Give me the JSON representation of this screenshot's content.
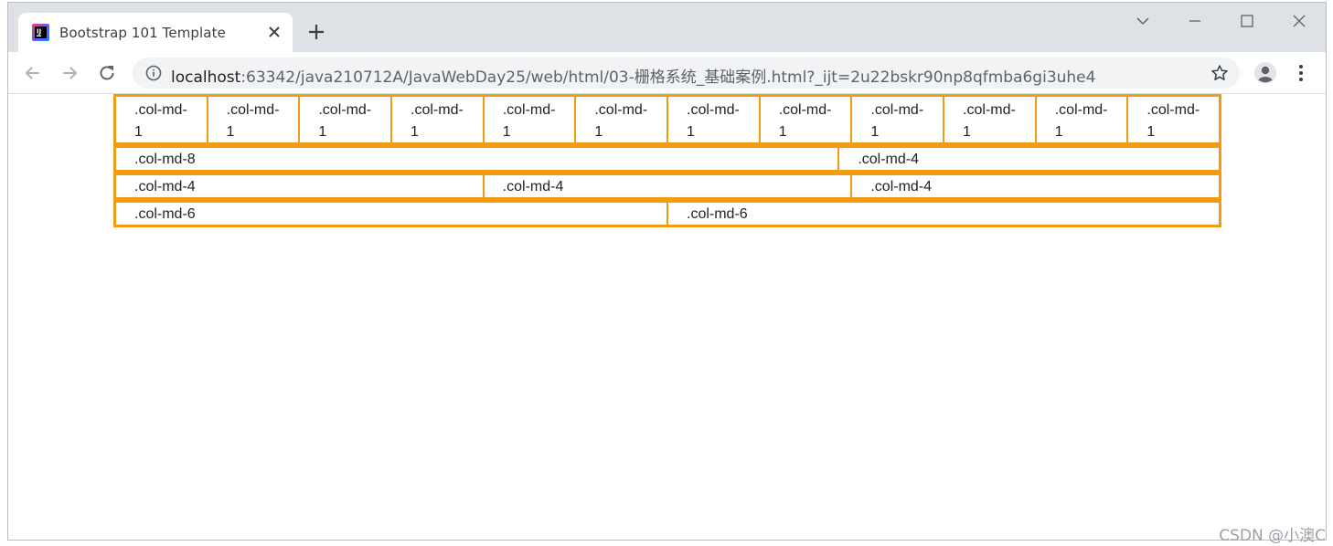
{
  "browser": {
    "tab_title": "Bootstrap 101 Template",
    "url_host": "localhost",
    "url_rest": ":63342/java210712A/JavaWebDay25/web/html/03-栅格系统_基础案例.html?_ijt=2u22bskr90np8qfmba6gi3uhe4"
  },
  "grid": {
    "row1": [
      ".col-md-1",
      ".col-md-1",
      ".col-md-1",
      ".col-md-1",
      ".col-md-1",
      ".col-md-1",
      ".col-md-1",
      ".col-md-1",
      ".col-md-1",
      ".col-md-1",
      ".col-md-1",
      ".col-md-1"
    ],
    "row2": [
      ".col-md-8",
      ".col-md-4"
    ],
    "row3": [
      ".col-md-4",
      ".col-md-4",
      ".col-md-4"
    ],
    "row4": [
      ".col-md-6",
      ".col-md-6"
    ]
  },
  "colors": {
    "grid_border": "#f39c12",
    "tabstrip": "#dee1e6",
    "omnibox": "#f1f3f4"
  },
  "watermark": "CSDN @小澳C"
}
